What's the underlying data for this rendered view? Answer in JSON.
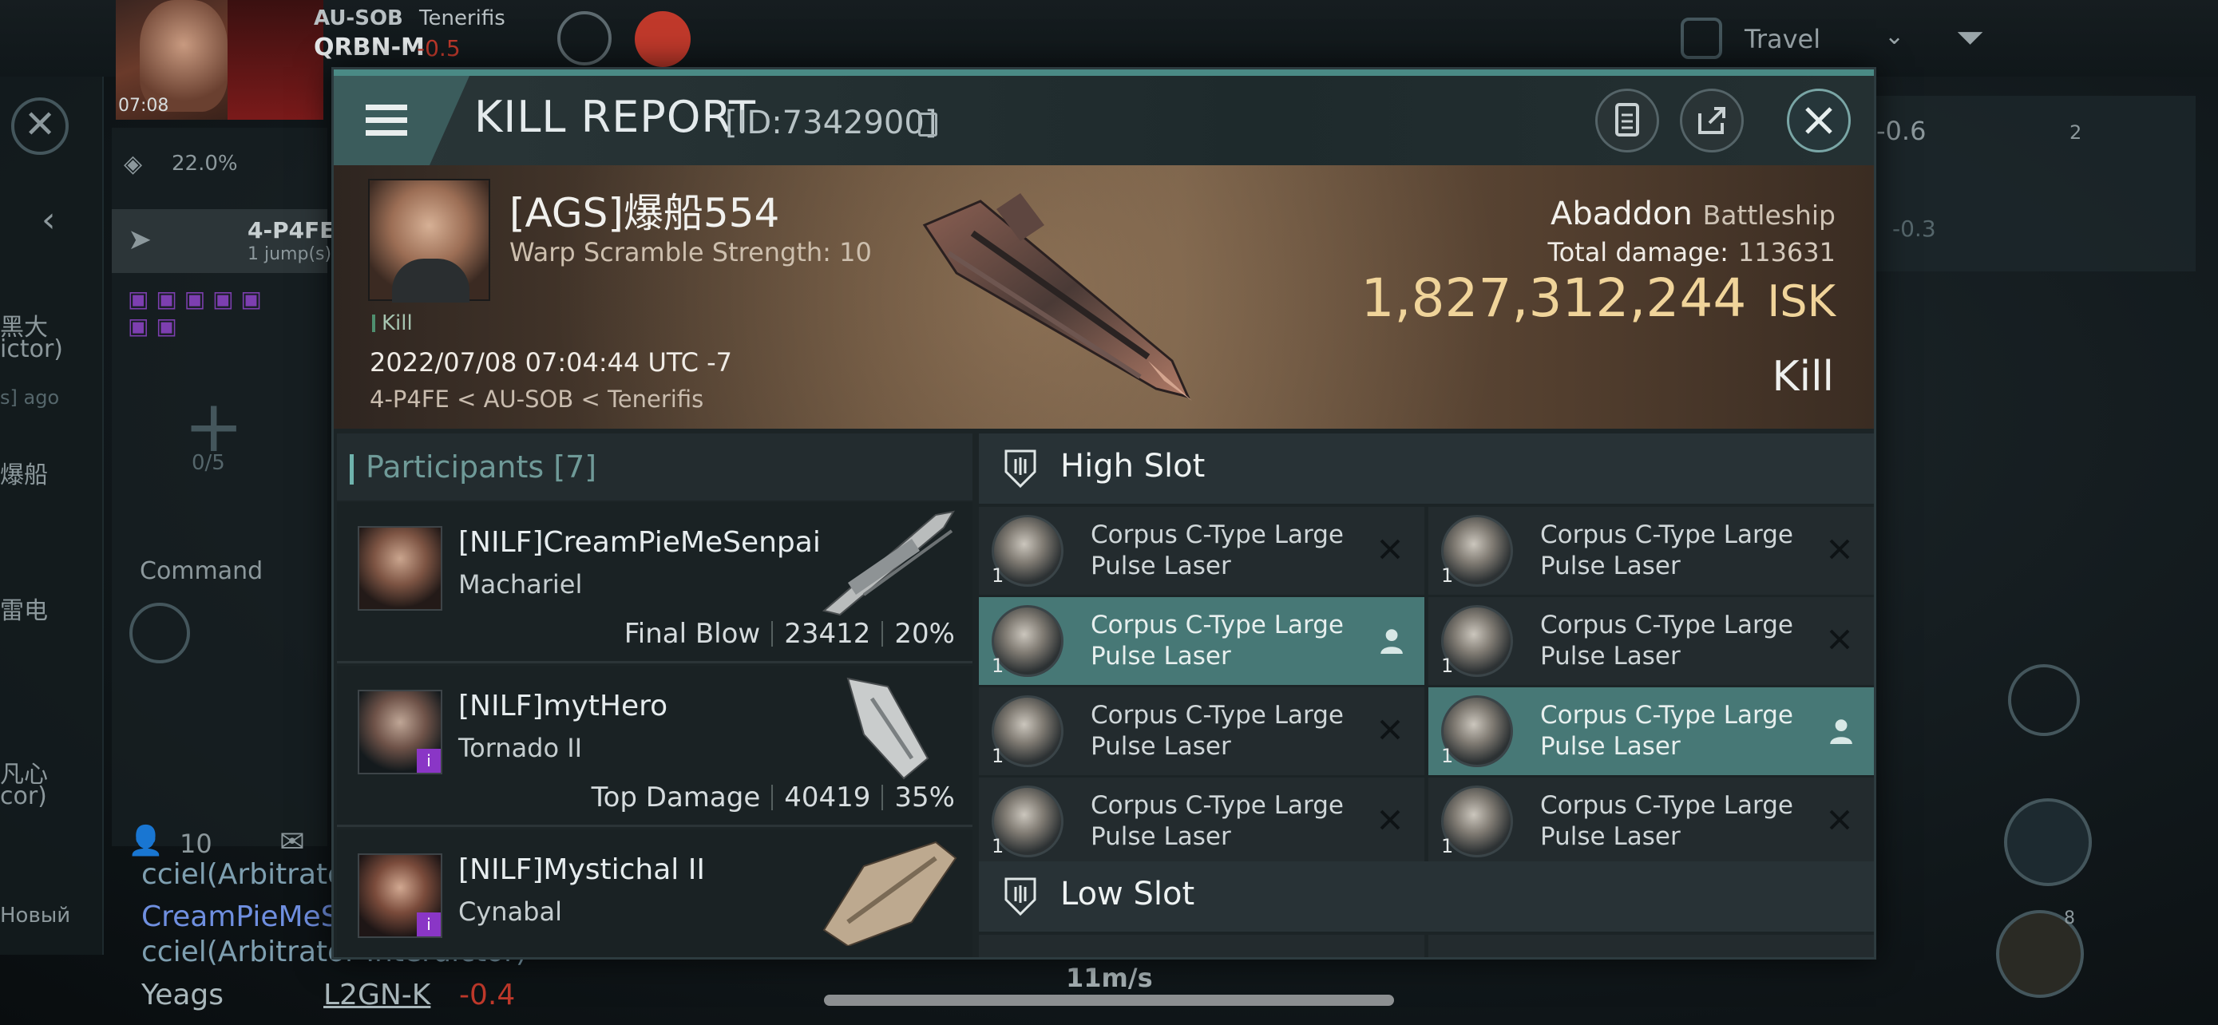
{
  "background": {
    "corp_name": "AU-SOB",
    "region": "Tenerifis",
    "system_name": "QRBN-M",
    "system_sec": "-0.5",
    "clock": "07:08",
    "cargo_percent": "22.0%",
    "nav_system": "4-P4FE",
    "nav_jumps": "1 jump(s)",
    "travel_label": "Travel",
    "right_sec_1": "-0.6",
    "right_sec_2": "-0.3",
    "right_count": "2",
    "fleet_slots": "0/5",
    "command_label": "Command",
    "local_count": "10",
    "chat_line_1": "cciel(Arbitrator",
    "chat_line_2": "CreamPieMeS",
    "chat_line_3": "cciel(Arbitrator Interdictor)",
    "chat_user": "Yeags",
    "chat_system": "L2GN-K",
    "chat_sec": "-0.4",
    "speed": "11m/s",
    "right_badge": "8",
    "left_fragments": [
      "黑大",
      "ictor)",
      "s] ago",
      "爆船",
      "雷电",
      "凡心",
      "cor)",
      "Новый"
    ]
  },
  "header": {
    "title": "KILL REPORT",
    "id": "[ID:7342900]"
  },
  "victim": {
    "name": "[AGS]爆船554",
    "warp_scramble": "Warp Scramble Strength: 10",
    "tag": "Kill",
    "timestamp": "2022/07/08 07:04:44 UTC -7",
    "location": "4-P4FE < AU-SOB < Tenerifis",
    "ship_name": "Abaddon",
    "ship_class": "Battleship",
    "total_damage_label": "Total damage:",
    "total_damage": "113631",
    "isk_value": "1,827,312,244",
    "isk_unit": "ISK",
    "result": "Kill"
  },
  "participants": {
    "header": "Participants [7]",
    "rows": [
      {
        "name": "[NILF]CreamPieMeSenpai",
        "ship": "Machariel",
        "role": "Final Blow",
        "damage": "23412",
        "percent": "20%",
        "badge": ""
      },
      {
        "name": "[NILF]mytHero",
        "ship": "Tornado II",
        "role": "Top Damage",
        "damage": "40419",
        "percent": "35%",
        "badge": "i"
      },
      {
        "name": "[NILF]Mystichal II",
        "ship": "Cynabal",
        "role": "",
        "damage": "",
        "percent": "",
        "badge": "i"
      }
    ]
  },
  "slots": {
    "high_slot_label": "High Slot",
    "low_slot_label": "Low Slot",
    "high": [
      {
        "name": "Corpus C-Type Large Pulse Laser",
        "qty": "1",
        "status": "destroyed"
      },
      {
        "name": "Corpus C-Type Large Pulse Laser",
        "qty": "1",
        "status": "destroyed"
      },
      {
        "name": "Corpus C-Type Large Pulse Laser",
        "qty": "1",
        "status": "dropped"
      },
      {
        "name": "Corpus C-Type Large Pulse Laser",
        "qty": "1",
        "status": "destroyed"
      },
      {
        "name": "Corpus C-Type Large Pulse Laser",
        "qty": "1",
        "status": "destroyed"
      },
      {
        "name": "Corpus C-Type Large Pulse Laser",
        "qty": "1",
        "status": "dropped"
      },
      {
        "name": "Corpus C-Type Large Pulse Laser",
        "qty": "1",
        "status": "destroyed"
      },
      {
        "name": "Corpus C-Type Large Pulse Laser",
        "qty": "1",
        "status": "destroyed"
      }
    ]
  },
  "colors": {
    "accent_teal": "#477876",
    "isk_gold": "#f0d49a",
    "badge_purple": "#8a36c6",
    "sec_red": "#c0392b"
  }
}
